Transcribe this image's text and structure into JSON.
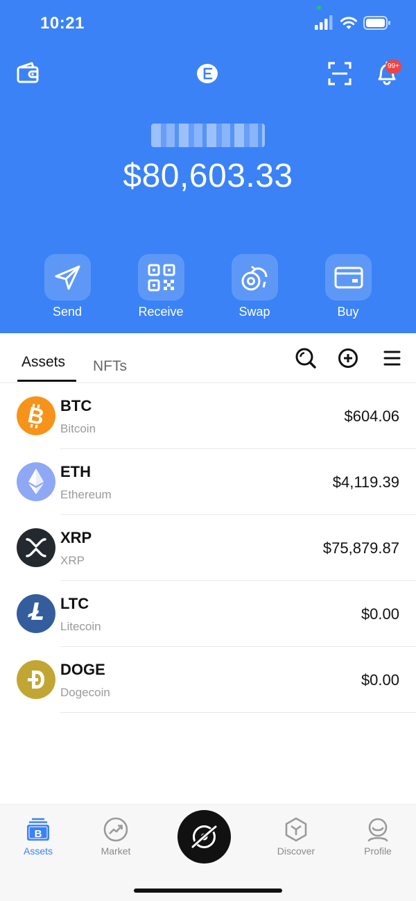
{
  "status_bar": {
    "time": "10:21"
  },
  "header": {
    "notification_badge": "99+",
    "total_balance": "$80,603.33"
  },
  "actions": [
    {
      "label": "Send",
      "icon": "send-icon"
    },
    {
      "label": "Receive",
      "icon": "qr-code-icon"
    },
    {
      "label": "Swap",
      "icon": "swap-icon"
    },
    {
      "label": "Buy",
      "icon": "card-icon"
    }
  ],
  "tabs": {
    "assets": "Assets",
    "nfts": "NFTs"
  },
  "assets": [
    {
      "symbol": "BTC",
      "name": "Bitcoin",
      "value": "$604.06",
      "color": "#f7931a"
    },
    {
      "symbol": "ETH",
      "name": "Ethereum",
      "value": "$4,119.39",
      "color": "#8fa8f5"
    },
    {
      "symbol": "XRP",
      "name": "XRP",
      "value": "$75,879.87",
      "color": "#23292f"
    },
    {
      "symbol": "LTC",
      "name": "Litecoin",
      "value": "$0.00",
      "color": "#345d9d"
    },
    {
      "symbol": "DOGE",
      "name": "Dogecoin",
      "value": "$0.00",
      "color": "#c2a633"
    }
  ],
  "bottom_nav": {
    "assets": "Assets",
    "market": "Market",
    "discover": "Discover",
    "profile": "Profile"
  },
  "colors": {
    "brand_blue": "#3b82f6",
    "badge_red": "#ef4444"
  }
}
